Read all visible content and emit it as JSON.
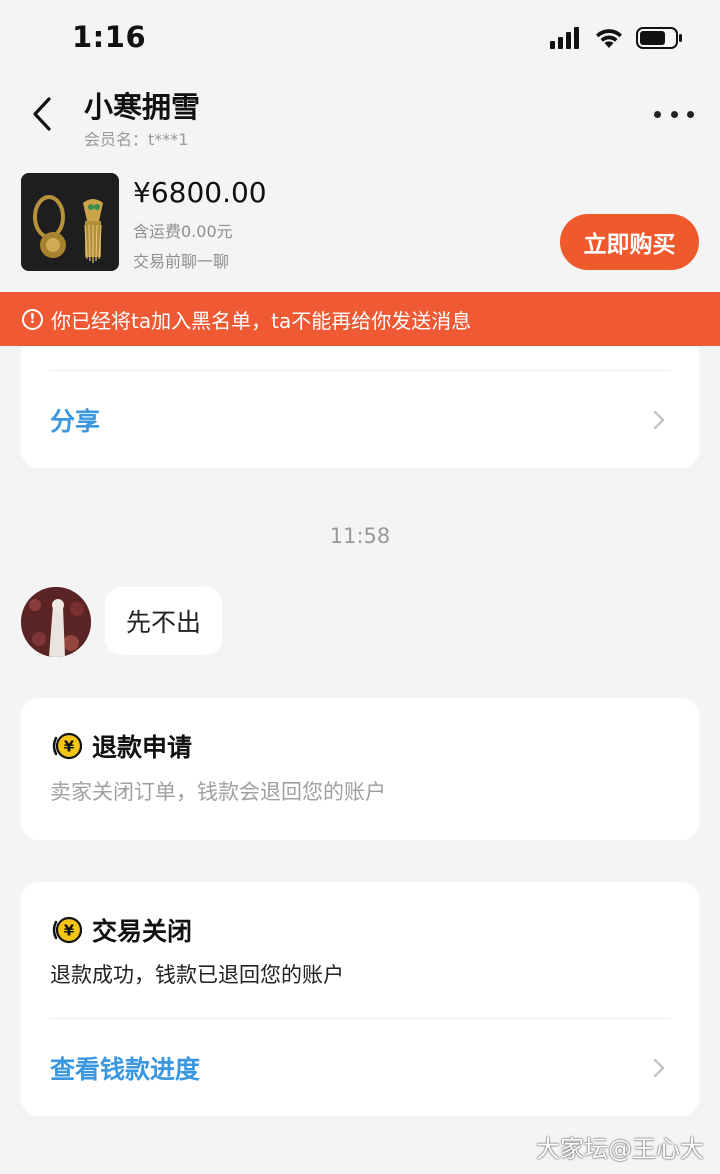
{
  "status_bar": {
    "time": "1:16"
  },
  "header": {
    "chat_name": "小寒拥雪",
    "member_label": "会员名：",
    "member_id": "t***1"
  },
  "product": {
    "price": "¥6800.00",
    "shipping": "含运费0.00元",
    "chat_hint": "交易前聊一聊",
    "buy_label": "立即购买"
  },
  "banner": {
    "text": "你已经将ta加入黑名单，ta不能再给你发送消息"
  },
  "share_card": {
    "link_label": "分享"
  },
  "chat": {
    "timestamp": "11:58",
    "message": "先不出"
  },
  "refund_card": {
    "title": "退款申请",
    "description": "卖家关闭订单，钱款会退回您的账户"
  },
  "closed_card": {
    "title": "交易关闭",
    "description": "退款成功，钱款已退回您的账户",
    "link_label": "查看钱款进度"
  },
  "watermark": "大家坛@王心大",
  "colors": {
    "accent": "#ef5a2c",
    "banner": "#ef5a35",
    "link": "#3a97e0",
    "coin": "#f5c518"
  }
}
